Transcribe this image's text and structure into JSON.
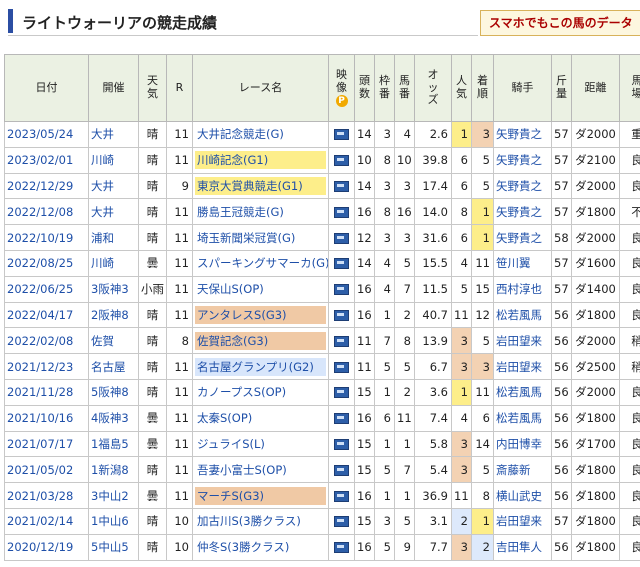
{
  "page": {
    "title": "ライトウォーリアの競走成績",
    "promo": "スマホでもこの馬のデータ"
  },
  "table": {
    "headers": {
      "date": "日付",
      "venue": "開催",
      "weather": "天気",
      "race": "R",
      "race_name": "レース名",
      "video": "映像",
      "runners": "頭数",
      "gate": "枠番",
      "horse_no": "馬番",
      "odds": "オッズ",
      "popularity": "人気",
      "finish": "着順",
      "jockey": "騎手",
      "weight": "斤量",
      "distance": "距離",
      "track": "馬場"
    },
    "video_badge": "P",
    "rows": [
      {
        "date": "2023/05/24",
        "venue": "大井",
        "weather": "晴",
        "race": "11",
        "race_name": "大井記念競走(G)",
        "grade": "",
        "runners": "14",
        "gate": "3",
        "horse_no": "4",
        "odds": "2.6",
        "popularity": "1",
        "finish": "3",
        "jockey": "矢野貴之",
        "weight": "57",
        "distance": "ダ2000",
        "track": "重"
      },
      {
        "date": "2023/02/01",
        "venue": "川崎",
        "weather": "晴",
        "race": "11",
        "race_name": "川崎記念(G1)",
        "grade": "g1",
        "runners": "10",
        "gate": "8",
        "horse_no": "10",
        "odds": "39.8",
        "popularity": "6",
        "finish": "5",
        "jockey": "矢野貴之",
        "weight": "57",
        "distance": "ダ2100",
        "track": "良"
      },
      {
        "date": "2022/12/29",
        "venue": "大井",
        "weather": "晴",
        "race": "9",
        "race_name": "東京大賞典競走(G1)",
        "grade": "g1",
        "runners": "14",
        "gate": "3",
        "horse_no": "3",
        "odds": "17.4",
        "popularity": "6",
        "finish": "5",
        "jockey": "矢野貴之",
        "weight": "57",
        "distance": "ダ2000",
        "track": "良"
      },
      {
        "date": "2022/12/08",
        "venue": "大井",
        "weather": "晴",
        "race": "11",
        "race_name": "勝島王冠競走(G)",
        "grade": "",
        "runners": "16",
        "gate": "8",
        "horse_no": "16",
        "odds": "14.0",
        "popularity": "8",
        "finish": "1",
        "jockey": "矢野貴之",
        "weight": "57",
        "distance": "ダ1800",
        "track": "不"
      },
      {
        "date": "2022/10/19",
        "venue": "浦和",
        "weather": "晴",
        "race": "11",
        "race_name": "埼玉新聞栄冠賞(G)",
        "grade": "",
        "runners": "12",
        "gate": "3",
        "horse_no": "3",
        "odds": "31.6",
        "popularity": "6",
        "finish": "1",
        "jockey": "矢野貴之",
        "weight": "58",
        "distance": "ダ2000",
        "track": "良"
      },
      {
        "date": "2022/08/25",
        "venue": "川崎",
        "weather": "曇",
        "race": "11",
        "race_name": "スパーキングサマーカ(G)",
        "grade": "",
        "runners": "14",
        "gate": "4",
        "horse_no": "5",
        "odds": "15.5",
        "popularity": "4",
        "finish": "11",
        "jockey": "笹川翼",
        "weight": "57",
        "distance": "ダ1600",
        "track": "良"
      },
      {
        "date": "2022/06/25",
        "venue": "3阪神3",
        "weather": "小雨",
        "race": "11",
        "race_name": "天保山S(OP)",
        "grade": "",
        "runners": "16",
        "gate": "4",
        "horse_no": "7",
        "odds": "11.5",
        "popularity": "5",
        "finish": "15",
        "jockey": "西村淳也",
        "weight": "57",
        "distance": "ダ1400",
        "track": "良"
      },
      {
        "date": "2022/04/17",
        "venue": "2阪神8",
        "weather": "晴",
        "race": "11",
        "race_name": "アンタレスS(G3)",
        "grade": "g3",
        "runners": "16",
        "gate": "1",
        "horse_no": "2",
        "odds": "40.7",
        "popularity": "11",
        "finish": "12",
        "jockey": "松若風馬",
        "weight": "56",
        "distance": "ダ1800",
        "track": "良"
      },
      {
        "date": "2022/02/08",
        "venue": "佐賀",
        "weather": "晴",
        "race": "8",
        "race_name": "佐賀記念(G3)",
        "grade": "g3",
        "runners": "11",
        "gate": "7",
        "horse_no": "8",
        "odds": "13.9",
        "popularity": "3",
        "finish": "5",
        "jockey": "岩田望来",
        "weight": "56",
        "distance": "ダ2000",
        "track": "稍"
      },
      {
        "date": "2021/12/23",
        "venue": "名古屋",
        "weather": "晴",
        "race": "11",
        "race_name": "名古屋グランプリ(G2)",
        "grade": "g2",
        "runners": "11",
        "gate": "5",
        "horse_no": "5",
        "odds": "6.7",
        "popularity": "3",
        "finish": "3",
        "jockey": "岩田望来",
        "weight": "56",
        "distance": "ダ2500",
        "track": "稍"
      },
      {
        "date": "2021/11/28",
        "venue": "5阪神8",
        "weather": "晴",
        "race": "11",
        "race_name": "カノープスS(OP)",
        "grade": "",
        "runners": "15",
        "gate": "1",
        "horse_no": "2",
        "odds": "3.6",
        "popularity": "1",
        "finish": "11",
        "jockey": "松若風馬",
        "weight": "56",
        "distance": "ダ2000",
        "track": "良"
      },
      {
        "date": "2021/10/16",
        "venue": "4阪神3",
        "weather": "曇",
        "race": "11",
        "race_name": "太秦S(OP)",
        "grade": "",
        "runners": "16",
        "gate": "6",
        "horse_no": "11",
        "odds": "7.4",
        "popularity": "4",
        "finish": "6",
        "jockey": "松若風馬",
        "weight": "56",
        "distance": "ダ1800",
        "track": "良"
      },
      {
        "date": "2021/07/17",
        "venue": "1福島5",
        "weather": "曇",
        "race": "11",
        "race_name": "ジュライS(L)",
        "grade": "",
        "runners": "15",
        "gate": "1",
        "horse_no": "1",
        "odds": "5.8",
        "popularity": "3",
        "finish": "14",
        "jockey": "内田博幸",
        "weight": "56",
        "distance": "ダ1700",
        "track": "良"
      },
      {
        "date": "2021/05/02",
        "venue": "1新潟8",
        "weather": "晴",
        "race": "11",
        "race_name": "吾妻小富士S(OP)",
        "grade": "",
        "runners": "15",
        "gate": "5",
        "horse_no": "7",
        "odds": "5.4",
        "popularity": "3",
        "finish": "5",
        "jockey": "斎藤新",
        "weight": "56",
        "distance": "ダ1800",
        "track": "良"
      },
      {
        "date": "2021/03/28",
        "venue": "3中山2",
        "weather": "曇",
        "race": "11",
        "race_name": "マーチS(G3)",
        "grade": "g3",
        "runners": "16",
        "gate": "1",
        "horse_no": "1",
        "odds": "36.9",
        "popularity": "11",
        "finish": "8",
        "jockey": "横山武史",
        "weight": "56",
        "distance": "ダ1800",
        "track": "良"
      },
      {
        "date": "2021/02/14",
        "venue": "1中山6",
        "weather": "晴",
        "race": "10",
        "race_name": "加古川S(3勝クラス)",
        "grade": "",
        "runners": "15",
        "gate": "3",
        "horse_no": "5",
        "odds": "3.1",
        "popularity": "2",
        "finish": "1",
        "jockey": "岩田望来",
        "weight": "57",
        "distance": "ダ1800",
        "track": "良"
      },
      {
        "date": "2020/12/19",
        "venue": "5中山5",
        "weather": "晴",
        "race": "10",
        "race_name": "仲冬S(3勝クラス)",
        "grade": "",
        "runners": "16",
        "gate": "5",
        "horse_no": "9",
        "odds": "7.7",
        "popularity": "3",
        "finish": "2",
        "jockey": "吉田隼人",
        "weight": "56",
        "distance": "ダ1800",
        "track": "良"
      }
    ]
  }
}
